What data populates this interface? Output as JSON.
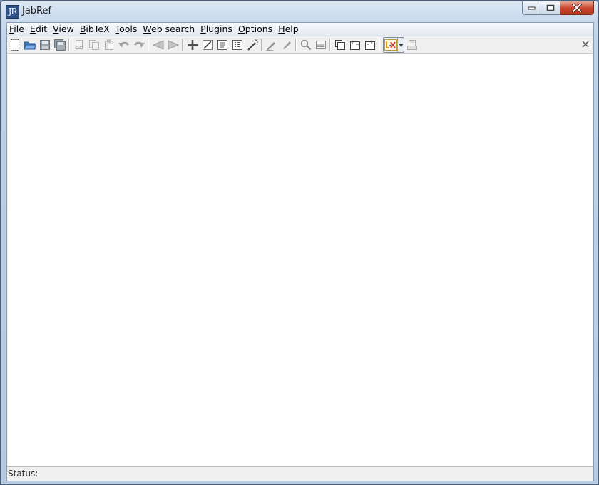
{
  "window": {
    "title": "JabRef",
    "app_icon_letters": "JR"
  },
  "menu": [
    {
      "label": "File",
      "mnemonic": "F",
      "rest": "ile"
    },
    {
      "label": "Edit",
      "mnemonic": "E",
      "rest": "dit"
    },
    {
      "label": "View",
      "mnemonic": "V",
      "rest": "iew"
    },
    {
      "label": "BibTeX",
      "mnemonic": "B",
      "rest": "ibTeX"
    },
    {
      "label": "Tools",
      "mnemonic": "T",
      "rest": "ools"
    },
    {
      "label": "Web search",
      "mnemonic": "W",
      "rest": "eb search"
    },
    {
      "label": "Plugins",
      "mnemonic": "P",
      "rest": "lugins"
    },
    {
      "label": "Options",
      "mnemonic": "O",
      "rest": "ptions"
    },
    {
      "label": "Help",
      "mnemonic": "H",
      "rest": "elp"
    }
  ],
  "toolbar": {
    "icons": [
      "new-database-icon",
      "open-folder-icon",
      "save-icon",
      "save-all-icon",
      "cut-icon",
      "copy-icon",
      "paste-icon",
      "undo-icon",
      "redo-icon",
      "back-icon",
      "forward-icon",
      "new-entry-icon",
      "edit-entry-icon",
      "edit-preamble-icon",
      "edit-strings-icon",
      "cleanup-wand-icon",
      "mark-entries-icon",
      "unmark-entries-icon",
      "search-icon",
      "toggle-groups-icon",
      "open-file-icon",
      "open-url-icon",
      "open-pdf-icon",
      "push-to-lyx-icon",
      "preview-icon"
    ]
  },
  "status": {
    "label": "Status:",
    "message": ""
  },
  "colors": {
    "title_bar": "#c8d9ec",
    "close_button": "#c7432a",
    "workarea": "#ffffff",
    "toolbar": "#f0f0f0"
  }
}
